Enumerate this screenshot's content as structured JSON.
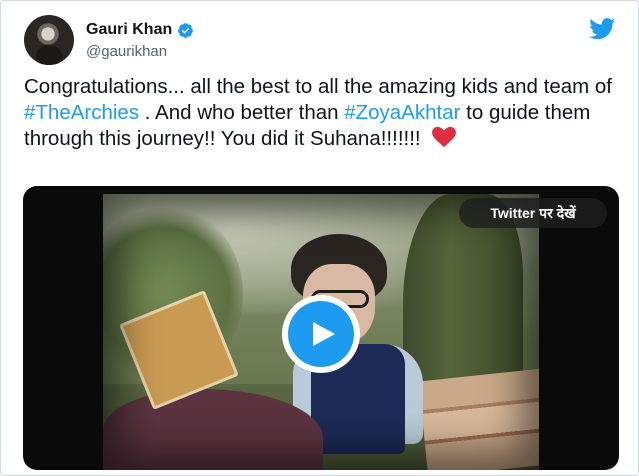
{
  "author": {
    "display_name": "Gauri Khan",
    "handle": "@gaurikhan",
    "verified": true,
    "avatar_icon": "profile-photo"
  },
  "brand": {
    "icon": "twitter-bird-icon",
    "color": "#1d9bf0"
  },
  "tweet": {
    "text_1": "Congratulations... all the best to all the amazing kids and team of ",
    "hashtag_1": "#TheArchies",
    "text_2": " . And who better than ",
    "hashtag_2": "#ZoyaAkhtar",
    "text_3": " to guide them through this journey!! You did it Suhana!!!!!!! ",
    "emoji": "heart-emoji",
    "hashtag_color": "#1d9bf0"
  },
  "media": {
    "type": "video",
    "watch_on_twitter_label": "Twitter पर देखें",
    "play_icon": "play-icon",
    "accent": "#1d9bf0"
  }
}
